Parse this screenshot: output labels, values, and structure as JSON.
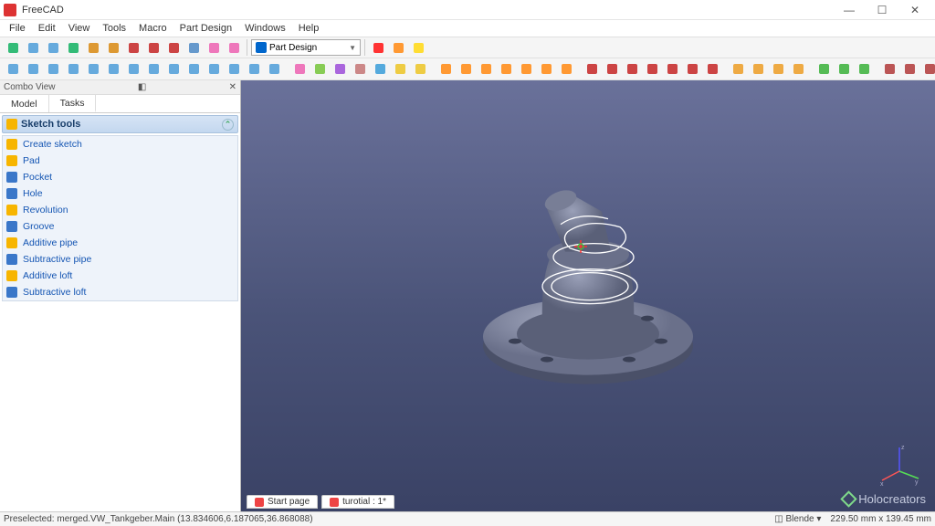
{
  "app": {
    "title": "FreeCAD"
  },
  "menu": {
    "items": [
      "File",
      "Edit",
      "View",
      "Tools",
      "Macro",
      "Part Design",
      "Windows",
      "Help"
    ]
  },
  "workbench": {
    "label": "Part Design"
  },
  "combo": {
    "title": "Combo View",
    "tabs": [
      "Model",
      "Tasks"
    ],
    "active_tab": 1,
    "section": "Sketch tools",
    "tools": [
      {
        "label": "Create sketch",
        "color": "#f7b500"
      },
      {
        "label": "Pad",
        "color": "#f7b500"
      },
      {
        "label": "Pocket",
        "color": "#3a77c9"
      },
      {
        "label": "Hole",
        "color": "#3a77c9"
      },
      {
        "label": "Revolution",
        "color": "#f7b500"
      },
      {
        "label": "Groove",
        "color": "#3a77c9"
      },
      {
        "label": "Additive pipe",
        "color": "#f7b500"
      },
      {
        "label": "Subtractive pipe",
        "color": "#3a77c9"
      },
      {
        "label": "Additive loft",
        "color": "#f7b500"
      },
      {
        "label": "Subtractive loft",
        "color": "#3a77c9"
      }
    ]
  },
  "docs": {
    "tabs": [
      "Start page",
      "turotial : 1*"
    ]
  },
  "status": {
    "left": "Preselected: merged.VW_Tankgeber.Main (13.834606,6.187065,36.868088)",
    "style_label": "Blende",
    "dims": "229.50 mm x 139.45 mm"
  },
  "watermark": "Holocreators",
  "axis": {
    "x": "x",
    "y": "y",
    "z": "z"
  },
  "toolbar_colors": {
    "row1": [
      "#3b7",
      "#6ad",
      "#6ad",
      "#3b7",
      "#d93",
      "#d93",
      "#c44",
      "#c44",
      "#c44",
      "#69c",
      "#e7b",
      "#e7b"
    ],
    "row1_b": [
      "#f33",
      "#f93",
      "#fd3"
    ],
    "row2_nav": [
      "#6ad",
      "#6ad",
      "#6ad",
      "#6ad",
      "#6ad",
      "#6ad",
      "#6ad",
      "#6ad",
      "#6ad",
      "#6ad",
      "#6ad",
      "#6ad",
      "#6ad",
      "#6ad"
    ],
    "row2_a": [
      "#e7b",
      "#8c5",
      "#a6d",
      "#c88",
      "#5ad",
      "#ec4",
      "#ec4"
    ],
    "row2_b": [
      "#f93",
      "#f93",
      "#f93",
      "#f93",
      "#f93",
      "#f93",
      "#f93"
    ],
    "row2_c": [
      "#c44",
      "#c44",
      "#c44",
      "#c44",
      "#c44",
      "#c44",
      "#c44"
    ],
    "row2_d": [
      "#ea4",
      "#ea4",
      "#ea4",
      "#ea4"
    ],
    "row2_e": [
      "#5b5",
      "#5b5",
      "#5b5"
    ],
    "row2_f": [
      "#b55",
      "#b55",
      "#b55",
      "#b55"
    ]
  }
}
